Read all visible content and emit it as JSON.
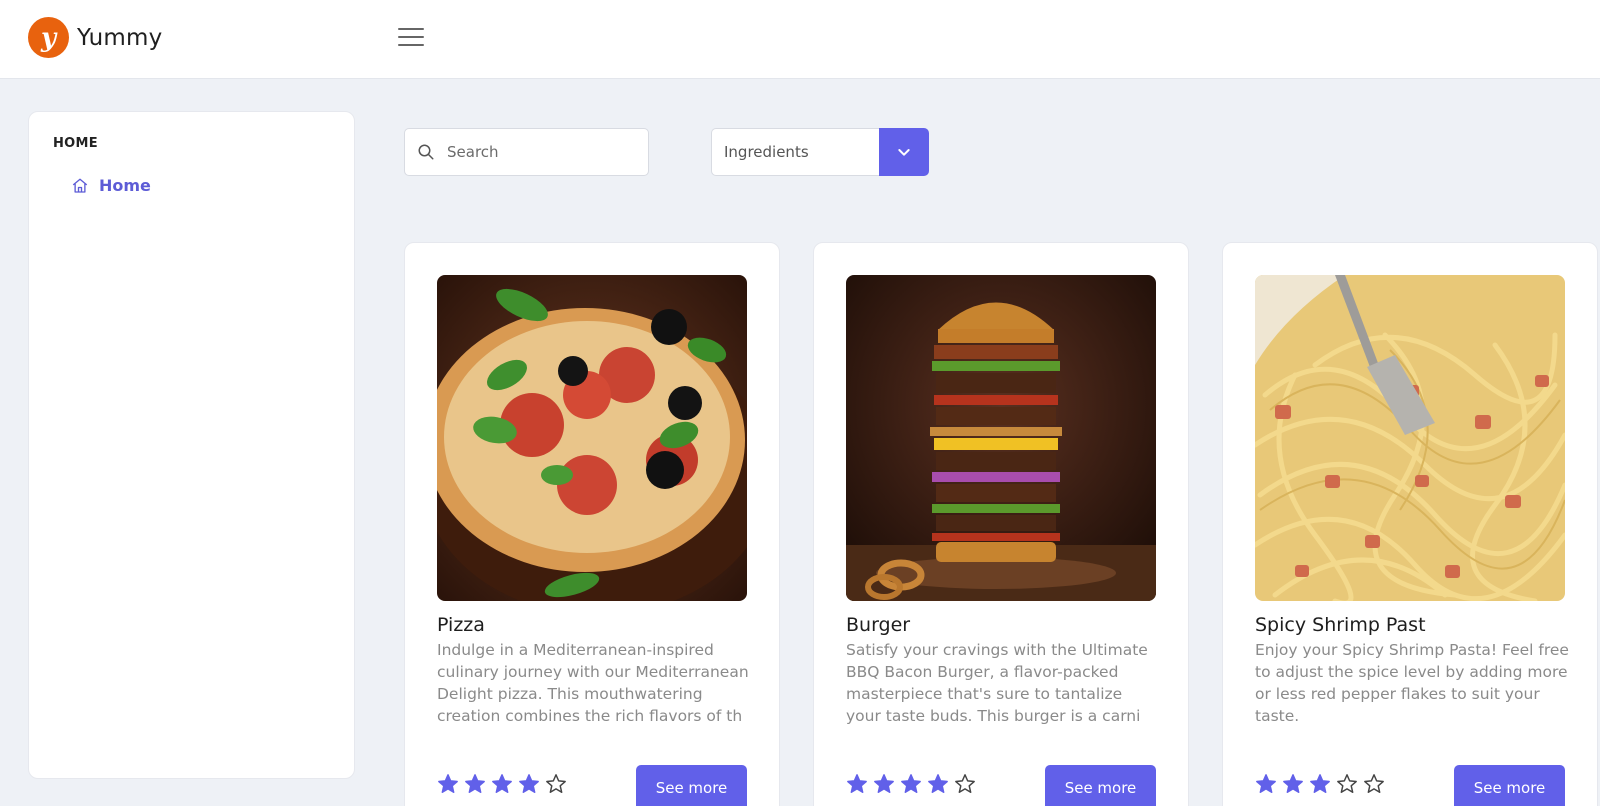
{
  "app": {
    "name": "Yummy",
    "logo_letter": "y",
    "brand_color": "#e8620e",
    "accent_color": "#6160e9"
  },
  "sidebar": {
    "heading": "HOME",
    "items": [
      {
        "label": "Home",
        "icon": "home-icon",
        "active": true
      }
    ]
  },
  "search": {
    "placeholder": "Search",
    "value": ""
  },
  "filter": {
    "selected": "Ingredients"
  },
  "recipes": [
    {
      "title": "Pizza",
      "description": "Indulge in a Mediterranean-inspired culinary journey with our Mediterranean Delight pizza. This mouthwatering creation combines the rich flavors of th",
      "rating": 4,
      "max_rating": 5,
      "button": "See more",
      "image": "pizza-photo"
    },
    {
      "title": "Burger",
      "description": "Satisfy your cravings with the Ultimate BBQ Bacon Burger, a flavor-packed masterpiece that's sure to tantalize your taste buds. This burger is a carni",
      "rating": 4,
      "max_rating": 5,
      "button": "See more",
      "image": "burger-photo"
    },
    {
      "title": "Spicy Shrimp Past",
      "description": "Enjoy your Spicy Shrimp Pasta! Feel free to adjust the spice level by adding more or less red pepper flakes to suit your taste.",
      "rating": 3,
      "max_rating": 5,
      "button": "See more",
      "image": "pasta-photo"
    }
  ]
}
